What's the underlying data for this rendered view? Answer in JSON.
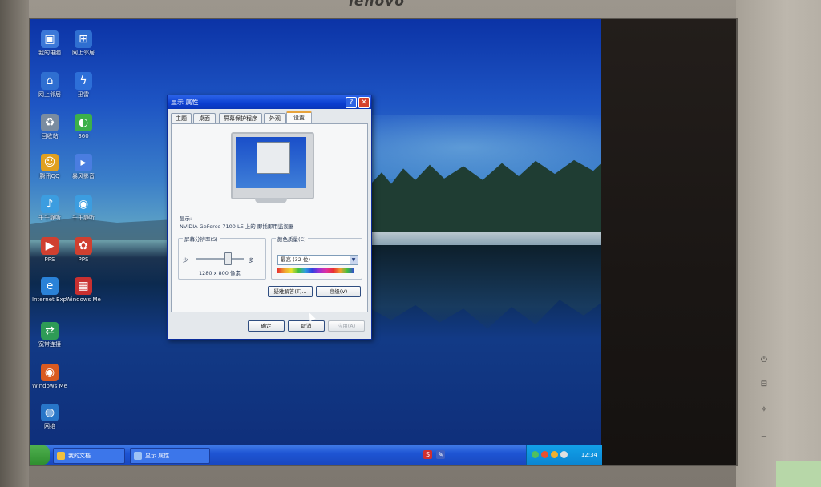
{
  "monitor": {
    "brand": "lenovo",
    "buttons": [
      "⏻",
      "⊟",
      "✧",
      "−"
    ]
  },
  "desktop_icons": [
    {
      "label": "我的电脑",
      "icon": "computer-icon",
      "color": "#3c78d8"
    },
    {
      "label": "网上邻居",
      "icon": "network-icon",
      "color": "#2f6fd1"
    },
    {
      "label": "回收站",
      "icon": "recycle-bin-icon",
      "color": "#7a8ca0"
    },
    {
      "label": "腾讯QQ",
      "icon": "qq-icon",
      "color": "#e0a020"
    },
    {
      "label": "千千静听",
      "icon": "music-player-icon",
      "color": "#3c9de0"
    },
    {
      "label": "暴风影音",
      "icon": "media-player-icon",
      "color": "#4a7de0"
    },
    {
      "label": "PPS",
      "icon": "pps-icon",
      "color": "#d04030"
    },
    {
      "label": "迅雷",
      "icon": "thunder-icon",
      "color": "#2d6fd8"
    },
    {
      "label": "360",
      "icon": "security-icon",
      "color": "#3cb04a"
    },
    {
      "label": "Internet Explorer",
      "icon": "ie-icon",
      "color": "#2a82d8"
    },
    {
      "label": "宽带连接",
      "icon": "broadband-icon",
      "color": "#2e9b56"
    },
    {
      "label": "Windows Media",
      "icon": "media-icon",
      "color": "#d95a20"
    },
    {
      "label": "网络",
      "icon": "globe-icon",
      "color": "#2876c8"
    }
  ],
  "dialog": {
    "title": "显示 属性",
    "tabs": [
      "主题",
      "桌面",
      "屏幕保护程序",
      "外观",
      "设置"
    ],
    "active_tab": "设置",
    "display_label": "显示:",
    "display_value": "NVIDIA GeForce 7100 LE 上的 即插即用监视器",
    "resolution_label": "屏幕分辨率(S)",
    "slider_less": "少",
    "slider_more": "多",
    "resolution_value": "1280 x 800 像素",
    "color_quality_label": "颜色质量(C)",
    "color_quality_value": "最高 (32 位)",
    "troubleshoot_button": "疑难解答(T)...",
    "advanced_button": "高级(V)",
    "ok_button": "确定",
    "cancel_button": "取消",
    "apply_button": "应用(A)",
    "help_glyph": "?",
    "close_glyph": "✕"
  },
  "taskbar": {
    "tasks": [
      "我的文档",
      "显示 属性"
    ],
    "center_icons": [
      {
        "icon": "sogou-icon",
        "glyph": "S",
        "color": "#d03030"
      },
      {
        "icon": "pen-icon",
        "glyph": "✎",
        "color": "#4060c0"
      }
    ],
    "clock": "12:34"
  }
}
